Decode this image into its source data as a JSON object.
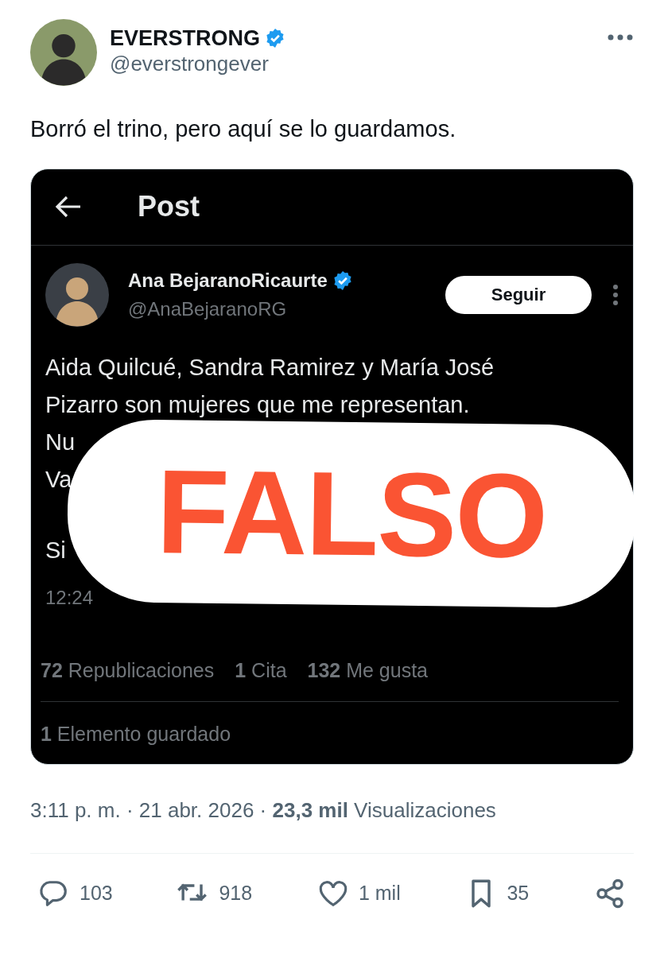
{
  "author": {
    "name": "EVERSTRONG",
    "verified": true,
    "handle": "@everstrongever"
  },
  "text": "Borró el trino, pero aquí se lo guardamos.",
  "embedded_screenshot": {
    "header": {
      "title": "Post"
    },
    "author": {
      "name": "Ana BejaranoRicaurte",
      "verified": true,
      "handle": "@AnaBejaranoRG",
      "follow_button": "Seguir"
    },
    "body_paragraphs": [
      [
        "Aida Quilcué, Sandra Ramirez y María José",
        "Pizarro son mujeres que me representan.",
        "Nu",
        "Va"
      ],
      [
        "Si"
      ]
    ],
    "time": "12:24",
    "stats": [
      "**72** Republicaciones",
      "**1** Cita",
      "**132** Me gusta"
    ],
    "saved": "**1** Elemento guardado",
    "stamp": "FALSO"
  },
  "meta": "3:11 p. m. · 21 abr. 2026 · **23,3 mil** Visualizaciones",
  "actions": [
    {
      "kind": "reply",
      "count": "103"
    },
    {
      "kind": "repost",
      "count": "918"
    },
    {
      "kind": "like",
      "count": "1 mil"
    },
    {
      "kind": "bookmark",
      "count": "35"
    },
    {
      "kind": "share"
    }
  ]
}
